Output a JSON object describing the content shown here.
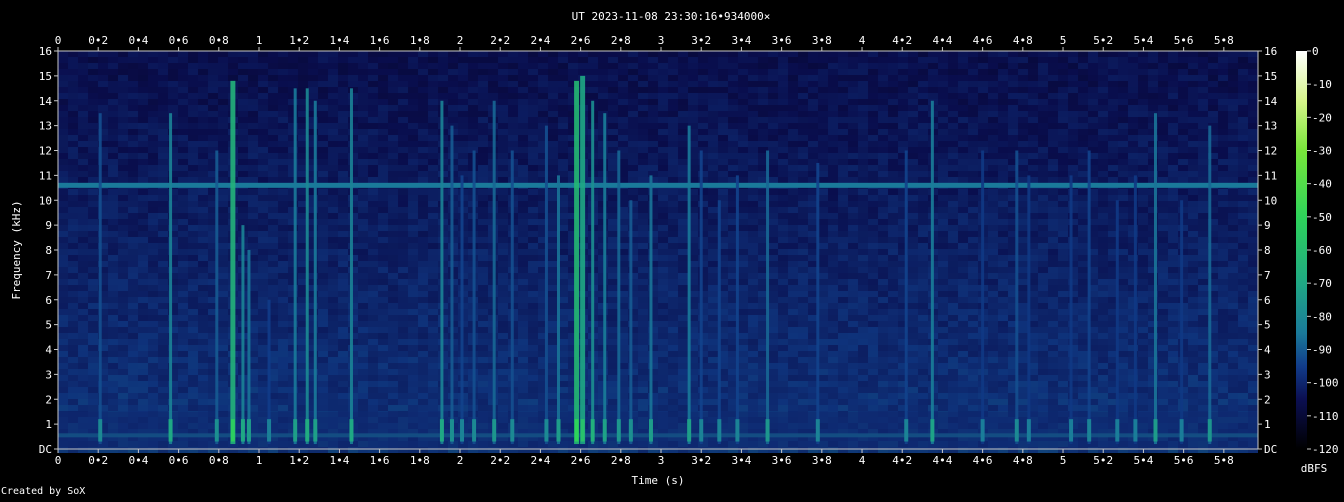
{
  "title": "UT 2023-11-08 23:30:16•934000×",
  "footer": "Created by SoX",
  "colors": {
    "background": "#000000",
    "plot_background": "#03062a",
    "text": "#ffffff",
    "axis": "#c8c8c8"
  },
  "chart_data": {
    "type": "heatmap",
    "title": "UT 2023-11-08 23:30:16•934000×",
    "xlabel": "Time (s)",
    "ylabel": "Frequency (kHz)",
    "xlim": [
      0,
      5.97
    ],
    "ylim": [
      0,
      16
    ],
    "x_ticks": [
      "0",
      "0•2",
      "0•4",
      "0•6",
      "0•8",
      "1",
      "1•2",
      "1•4",
      "1•6",
      "1•8",
      "2",
      "2•2",
      "2•4",
      "2•6",
      "2•8",
      "3",
      "3•2",
      "3•4",
      "3•6",
      "3•8",
      "4",
      "4•2",
      "4•4",
      "4•6",
      "4•8",
      "5",
      "5•2",
      "5•4",
      "5•6",
      "5•8"
    ],
    "x_tick_values": [
      0,
      0.2,
      0.4,
      0.6,
      0.8,
      1,
      1.2,
      1.4,
      1.6,
      1.8,
      2,
      2.2,
      2.4,
      2.6,
      2.8,
      3,
      3.2,
      3.4,
      3.6,
      3.8,
      4,
      4.2,
      4.4,
      4.6,
      4.8,
      5,
      5.2,
      5.4,
      5.6,
      5.8
    ],
    "y_ticks": [
      "DC",
      "1",
      "2",
      "3",
      "4",
      "5",
      "6",
      "7",
      "8",
      "9",
      "10",
      "11",
      "12",
      "13",
      "14",
      "15",
      "16"
    ],
    "y_tick_values": [
      0,
      1,
      2,
      3,
      4,
      5,
      6,
      7,
      8,
      9,
      10,
      11,
      12,
      13,
      14,
      15,
      16
    ],
    "colorbar": {
      "label": "dBFS",
      "ticks": [
        "0",
        "-10",
        "-20",
        "-30",
        "-40",
        "-50",
        "-60",
        "-70",
        "-80",
        "-90",
        "-100",
        "-110",
        "-120"
      ],
      "range": [
        -120,
        0
      ],
      "stops": [
        {
          "db": -120,
          "color": "#000000"
        },
        {
          "db": -105,
          "color": "#0b0f52"
        },
        {
          "db": -95,
          "color": "#113c8a"
        },
        {
          "db": -85,
          "color": "#1a7a9a"
        },
        {
          "db": -70,
          "color": "#1fa884"
        },
        {
          "db": -50,
          "color": "#2ed35a"
        },
        {
          "db": -30,
          "color": "#78e63a"
        },
        {
          "db": -15,
          "color": "#d6f58a"
        },
        {
          "db": 0,
          "color": "#ffffff"
        }
      ]
    },
    "tone_band": {
      "freq_khz": 10.6,
      "level_db": -85
    },
    "low_band": {
      "freq_khz": 0.55,
      "level_db": -85
    },
    "events": [
      {
        "t": 0.21,
        "fmax": 13.5,
        "level": -92
      },
      {
        "t": 0.56,
        "fmax": 13.5,
        "level": -82
      },
      {
        "t": 0.79,
        "fmax": 12,
        "level": -90
      },
      {
        "t": 0.87,
        "fmax": 14.8,
        "level": -65
      },
      {
        "t": 0.92,
        "fmax": 9,
        "level": -82
      },
      {
        "t": 0.95,
        "fmax": 8,
        "level": -86
      },
      {
        "t": 1.05,
        "fmax": 6,
        "level": -95
      },
      {
        "t": 1.18,
        "fmax": 14.5,
        "level": -85
      },
      {
        "t": 1.24,
        "fmax": 14.5,
        "level": -80
      },
      {
        "t": 1.28,
        "fmax": 14,
        "level": -85
      },
      {
        "t": 1.46,
        "fmax": 14.5,
        "level": -82
      },
      {
        "t": 1.91,
        "fmax": 14,
        "level": -82
      },
      {
        "t": 1.96,
        "fmax": 13,
        "level": -90
      },
      {
        "t": 2.01,
        "fmax": 11,
        "level": -94
      },
      {
        "t": 2.07,
        "fmax": 12,
        "level": -92
      },
      {
        "t": 2.17,
        "fmax": 14,
        "level": -88
      },
      {
        "t": 2.26,
        "fmax": 12,
        "level": -92
      },
      {
        "t": 2.43,
        "fmax": 13,
        "level": -92
      },
      {
        "t": 2.49,
        "fmax": 11,
        "level": -86
      },
      {
        "t": 2.58,
        "fmax": 14.8,
        "level": -62
      },
      {
        "t": 2.61,
        "fmax": 15,
        "level": -70
      },
      {
        "t": 2.66,
        "fmax": 14,
        "level": -78
      },
      {
        "t": 2.72,
        "fmax": 13.5,
        "level": -84
      },
      {
        "t": 2.79,
        "fmax": 12,
        "level": -88
      },
      {
        "t": 2.85,
        "fmax": 10,
        "level": -90
      },
      {
        "t": 2.95,
        "fmax": 11,
        "level": -86
      },
      {
        "t": 3.14,
        "fmax": 13,
        "level": -85
      },
      {
        "t": 3.2,
        "fmax": 12,
        "level": -94
      },
      {
        "t": 3.29,
        "fmax": 10,
        "level": -94
      },
      {
        "t": 3.38,
        "fmax": 11,
        "level": -94
      },
      {
        "t": 3.53,
        "fmax": 12,
        "level": -88
      },
      {
        "t": 3.78,
        "fmax": 11.5,
        "level": -94
      },
      {
        "t": 4.22,
        "fmax": 12,
        "level": -94
      },
      {
        "t": 4.35,
        "fmax": 14,
        "level": -84
      },
      {
        "t": 4.6,
        "fmax": 12,
        "level": -96
      },
      {
        "t": 4.77,
        "fmax": 12,
        "level": -92
      },
      {
        "t": 4.83,
        "fmax": 11,
        "level": -96
      },
      {
        "t": 5.04,
        "fmax": 11,
        "level": -96
      },
      {
        "t": 5.13,
        "fmax": 12,
        "level": -94
      },
      {
        "t": 5.27,
        "fmax": 10,
        "level": -96
      },
      {
        "t": 5.36,
        "fmax": 11,
        "level": -96
      },
      {
        "t": 5.46,
        "fmax": 13.5,
        "level": -86
      },
      {
        "t": 5.59,
        "fmax": 10,
        "level": -96
      },
      {
        "t": 5.73,
        "fmax": 13,
        "level": -88
      }
    ]
  }
}
